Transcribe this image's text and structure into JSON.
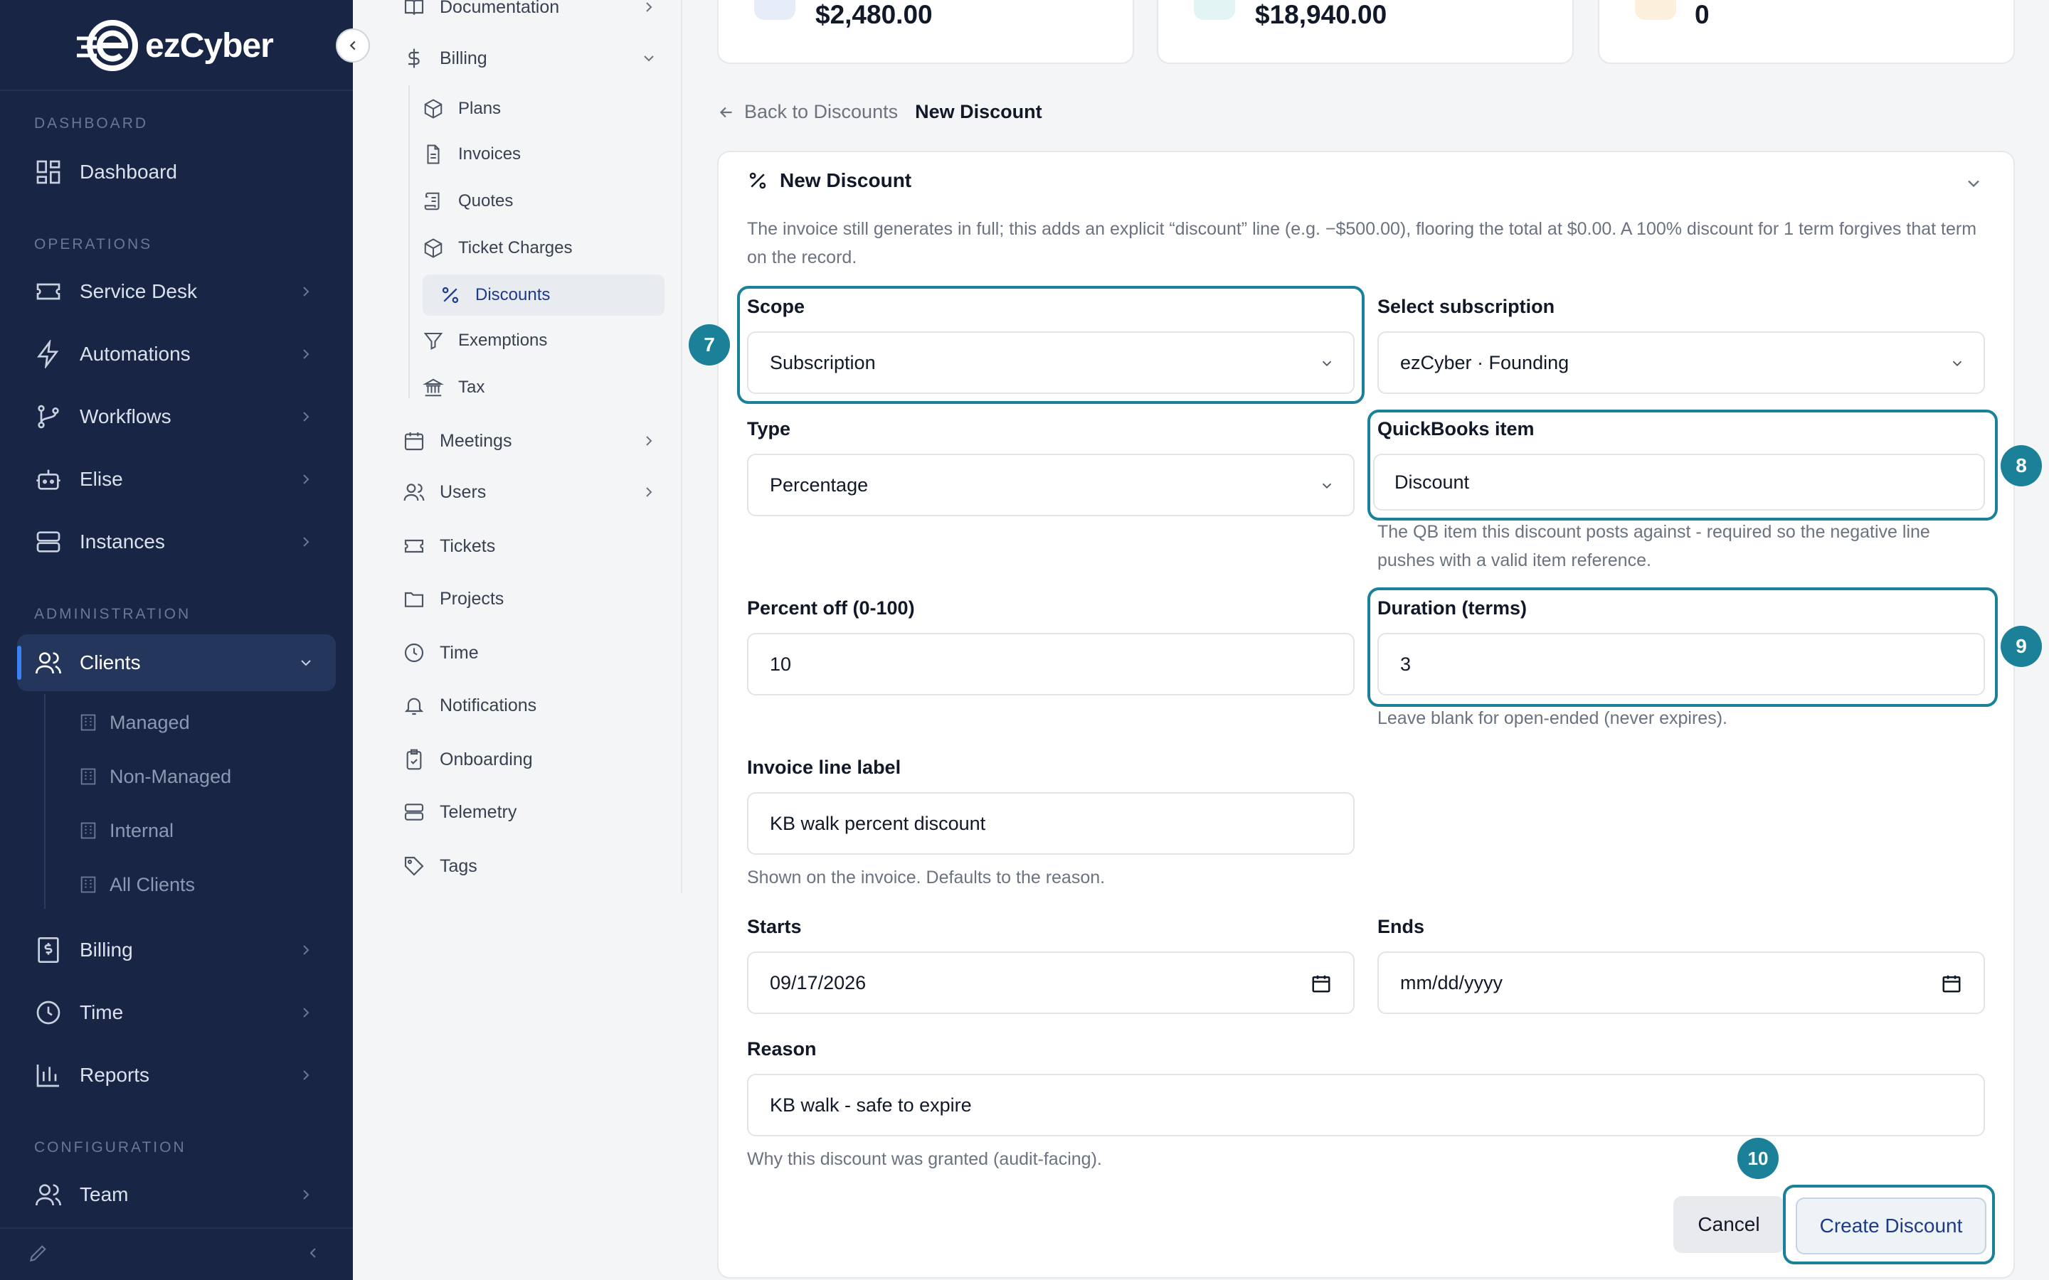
{
  "brand": {
    "logo_text_a": "ez",
    "logo_text_b": "Cyber"
  },
  "sidebar": {
    "sections": {
      "dashboard": "DASHBOARD",
      "operations": "OPERATIONS",
      "administration": "ADMINISTRATION",
      "configuration": "CONFIGURATION"
    },
    "items": {
      "dashboard": "Dashboard",
      "service_desk": "Service Desk",
      "automations": "Automations",
      "workflows": "Workflows",
      "elise": "Elise",
      "instances": "Instances",
      "clients": "Clients",
      "billing": "Billing",
      "time": "Time",
      "reports": "Reports",
      "team": "Team"
    },
    "client_sub": [
      "Managed",
      "Non-Managed",
      "Internal",
      "All Clients"
    ]
  },
  "subnav": {
    "documentation": "Documentation",
    "billing": "Billing",
    "billing_sub": [
      "Plans",
      "Invoices",
      "Quotes",
      "Ticket Charges",
      "Discounts",
      "Exemptions",
      "Tax"
    ],
    "meetings": "Meetings",
    "users": "Users",
    "tickets": "Tickets",
    "projects": "Projects",
    "time": "Time",
    "notifications": "Notifications",
    "onboarding": "Onboarding",
    "telemetry": "Telemetry",
    "tags": "Tags"
  },
  "stats": [
    "$2,480.00",
    "$18,940.00",
    "0"
  ],
  "breadcrumb": {
    "back": "Back to Discounts",
    "current": "New Discount"
  },
  "form": {
    "title": "New Discount",
    "description": "The invoice still generates in full; this adds an explicit “discount” line (e.g. −$500.00), flooring the total at $0.00. A 100% discount for 1 term forgives that term on the record.",
    "scope": {
      "label": "Scope",
      "value": "Subscription"
    },
    "subscription": {
      "label": "Select subscription",
      "value": "ezCyber · Founding"
    },
    "type": {
      "label": "Type",
      "value": "Percentage"
    },
    "qb_item": {
      "label": "QuickBooks item",
      "value": "Discount",
      "help": "The QB item this discount posts against - required so the negative line pushes with a valid item reference."
    },
    "percent_off": {
      "label": "Percent off (0-100)",
      "value": "10"
    },
    "duration": {
      "label": "Duration (terms)",
      "value": "3",
      "help": "Leave blank for open-ended (never expires)."
    },
    "invoice_line": {
      "label": "Invoice line label",
      "value": "KB walk percent discount",
      "help": "Shown on the invoice. Defaults to the reason."
    },
    "starts": {
      "label": "Starts",
      "value": "09/17/2026"
    },
    "ends": {
      "label": "Ends",
      "value": "mm/dd/yyyy"
    },
    "reason": {
      "label": "Reason",
      "value": "KB walk - safe to expire",
      "help": "Why this discount was granted (audit-facing)."
    },
    "cancel": "Cancel",
    "create": "Create Discount"
  },
  "annotations": [
    "7",
    "8",
    "9",
    "10"
  ],
  "colors": {
    "sidebar_bg": "#182544",
    "highlight": "#1b8198",
    "accent": "#1e3a8a"
  }
}
